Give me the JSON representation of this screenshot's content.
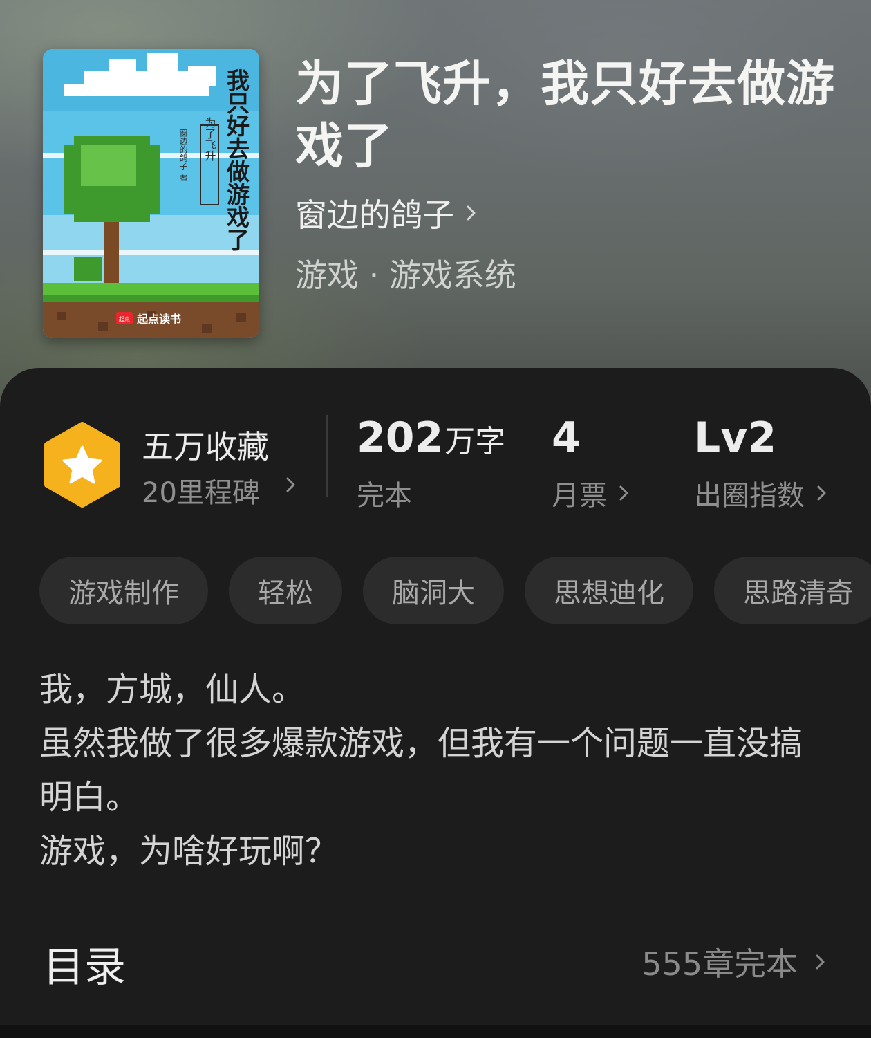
{
  "book": {
    "title": "为了飞升，我只好去做游戏了",
    "author": "窗边的鸽子",
    "genre": "游戏 · 游戏系统",
    "cover": {
      "title_vertical": "我只好去做游戏了",
      "subtitle_vertical": "为了飞升",
      "author_vertical": "窗边的鸽子 著",
      "publisher": "起点读书",
      "publisher_badge": "起点"
    }
  },
  "stats": {
    "collection": {
      "main": "五万收藏",
      "sub": "20里程碑"
    },
    "words": {
      "value": "202",
      "unit": "万字",
      "label": "完本"
    },
    "monthly_tickets": {
      "value": "4",
      "label": "月票"
    },
    "influence": {
      "value": "Lv2",
      "label": "出圈指数"
    }
  },
  "tags": [
    "游戏制作",
    "轻松",
    "脑洞大",
    "思想迪化",
    "思路清奇"
  ],
  "description": [
    "我，方城，仙人。",
    "虽然我做了很多爆款游戏，但我有一个问题一直没搞明白。",
    "游戏，为啥好玩啊？"
  ],
  "toc": {
    "title": "目录",
    "info": "555章完本"
  },
  "colors": {
    "panel": "#1c1c1c",
    "tag_bg": "#2c2c2c",
    "badge": "#f6b21c"
  }
}
